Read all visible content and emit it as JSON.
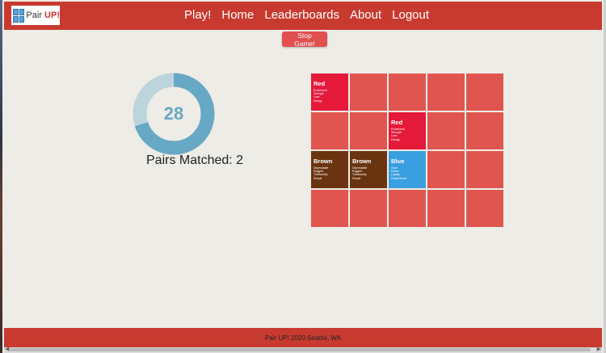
{
  "app": {
    "logo_prefix": "Pair ",
    "logo_suffix": "UP!"
  },
  "nav": [
    {
      "label": "Play!"
    },
    {
      "label": "Home"
    },
    {
      "label": "Leaderboards"
    },
    {
      "label": "About"
    },
    {
      "label": "Logout"
    }
  ],
  "stop_button": "Stop Game!",
  "timer": {
    "value": "28",
    "progress_fraction": 0.7
  },
  "pairs_matched": "Pairs Matched: 2",
  "board": {
    "rows": 4,
    "cols": 5,
    "cards": [
      {
        "title": "Red",
        "color": "#e5193a",
        "traits": [
          "Excitement",
          "Strength",
          "Love",
          "Energy"
        ]
      },
      {},
      {},
      {},
      {},
      {},
      {},
      {
        "title": "Red",
        "color": "#e5193a",
        "traits": [
          "Excitement",
          "Strength",
          "Love",
          "Energy"
        ]
      },
      {},
      {},
      {
        "title": "Brown",
        "color": "#6b3410",
        "traits": [
          "Dependable",
          "Rugged",
          "Trustworthy",
          "Simple"
        ]
      },
      {
        "title": "Brown",
        "color": "#6b3410",
        "traits": [
          "Dependable",
          "Rugged",
          "Trustworthy",
          "Simple"
        ]
      },
      {
        "title": "Blue",
        "color": "#3a9fe0",
        "traits": [
          "Trust",
          "Peace",
          "Loyalty",
          "Competence"
        ]
      },
      {},
      {},
      {},
      {},
      {},
      {},
      {}
    ],
    "hidden_color": "#e05550"
  },
  "footer": "Pair UP! 2020 Seattle, WA",
  "colors": {
    "brand": "#c83a30",
    "ring": "#67a9c4",
    "ring_track": "#bcd5dc"
  }
}
